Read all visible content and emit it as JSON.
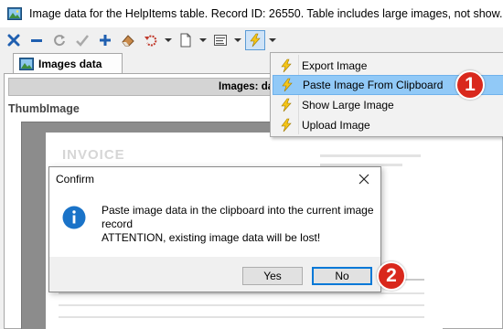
{
  "window": {
    "title": "Image data for the HelpItems table. Record ID: 26550. Table includes large images, not show..."
  },
  "toolbar": {
    "icons": [
      "close-x-icon",
      "minus-icon",
      "refresh-icon",
      "check-icon",
      "plus-icon",
      "eraser-icon",
      "undo-icon",
      "document-icon",
      "form-icon",
      "lightning-icon"
    ]
  },
  "tab": {
    "label": "Images data"
  },
  "grid": {
    "header": "Images: data II",
    "field_label": "ThumbImage"
  },
  "invoice_preview": {
    "title": "INVOICE"
  },
  "menu": {
    "items": [
      {
        "label": "Export Image",
        "icon": "lightning-icon"
      },
      {
        "label": "Paste Image From Clipboard",
        "icon": "lightning-icon",
        "highlighted": true
      },
      {
        "label": "Show Large Image",
        "icon": "lightning-icon"
      },
      {
        "label": "Upload Image",
        "icon": "lightning-icon"
      }
    ]
  },
  "dialog": {
    "title": "Confirm",
    "message_line1": "Paste image data in the clipboard into the current image",
    "message_line2": "record",
    "message_line3": "ATTENTION, existing image data will be lost!",
    "yes_label": "Yes",
    "no_label": "No"
  },
  "callouts": [
    "1",
    "2"
  ],
  "colors": {
    "accent": "#0078d7",
    "menu_highlight": "#91c9f7",
    "callout": "#d9281c",
    "lightning": "#f5c518"
  }
}
